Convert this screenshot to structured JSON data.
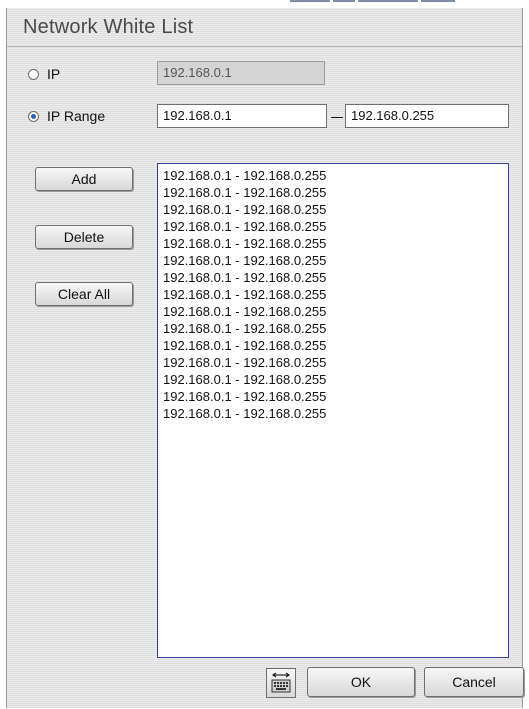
{
  "dialog": {
    "title": "Network White List"
  },
  "ip_option": {
    "label": "IP",
    "value": "192.168.0.1",
    "selected": false
  },
  "ip_range_option": {
    "label": "IP Range",
    "from": "192.168.0.1",
    "to": "192.168.0.255",
    "selected": true
  },
  "buttons": {
    "add": "Add",
    "delete": "Delete",
    "clear_all": "Clear All",
    "ok": "OK",
    "cancel": "Cancel"
  },
  "white_list": [
    "192.168.0.1 - 192.168.0.255",
    "192.168.0.1 - 192.168.0.255",
    "192.168.0.1 - 192.168.0.255",
    "192.168.0.1 - 192.168.0.255",
    "192.168.0.1 - 192.168.0.255",
    "192.168.0.1 - 192.168.0.255",
    "192.168.0.1 - 192.168.0.255",
    "192.168.0.1 - 192.168.0.255",
    "192.168.0.1 - 192.168.0.255",
    "192.168.0.1 - 192.168.0.255",
    "192.168.0.1 - 192.168.0.255",
    "192.168.0.1 - 192.168.0.255",
    "192.168.0.1 - 192.168.0.255",
    "192.168.0.1 - 192.168.0.255",
    "192.168.0.1 - 192.168.0.255"
  ],
  "icons": {
    "keyboard": "keyboard-icon"
  },
  "colors": {
    "selected_radio": "#2b64b8",
    "list_border": "#3b3b9c"
  }
}
